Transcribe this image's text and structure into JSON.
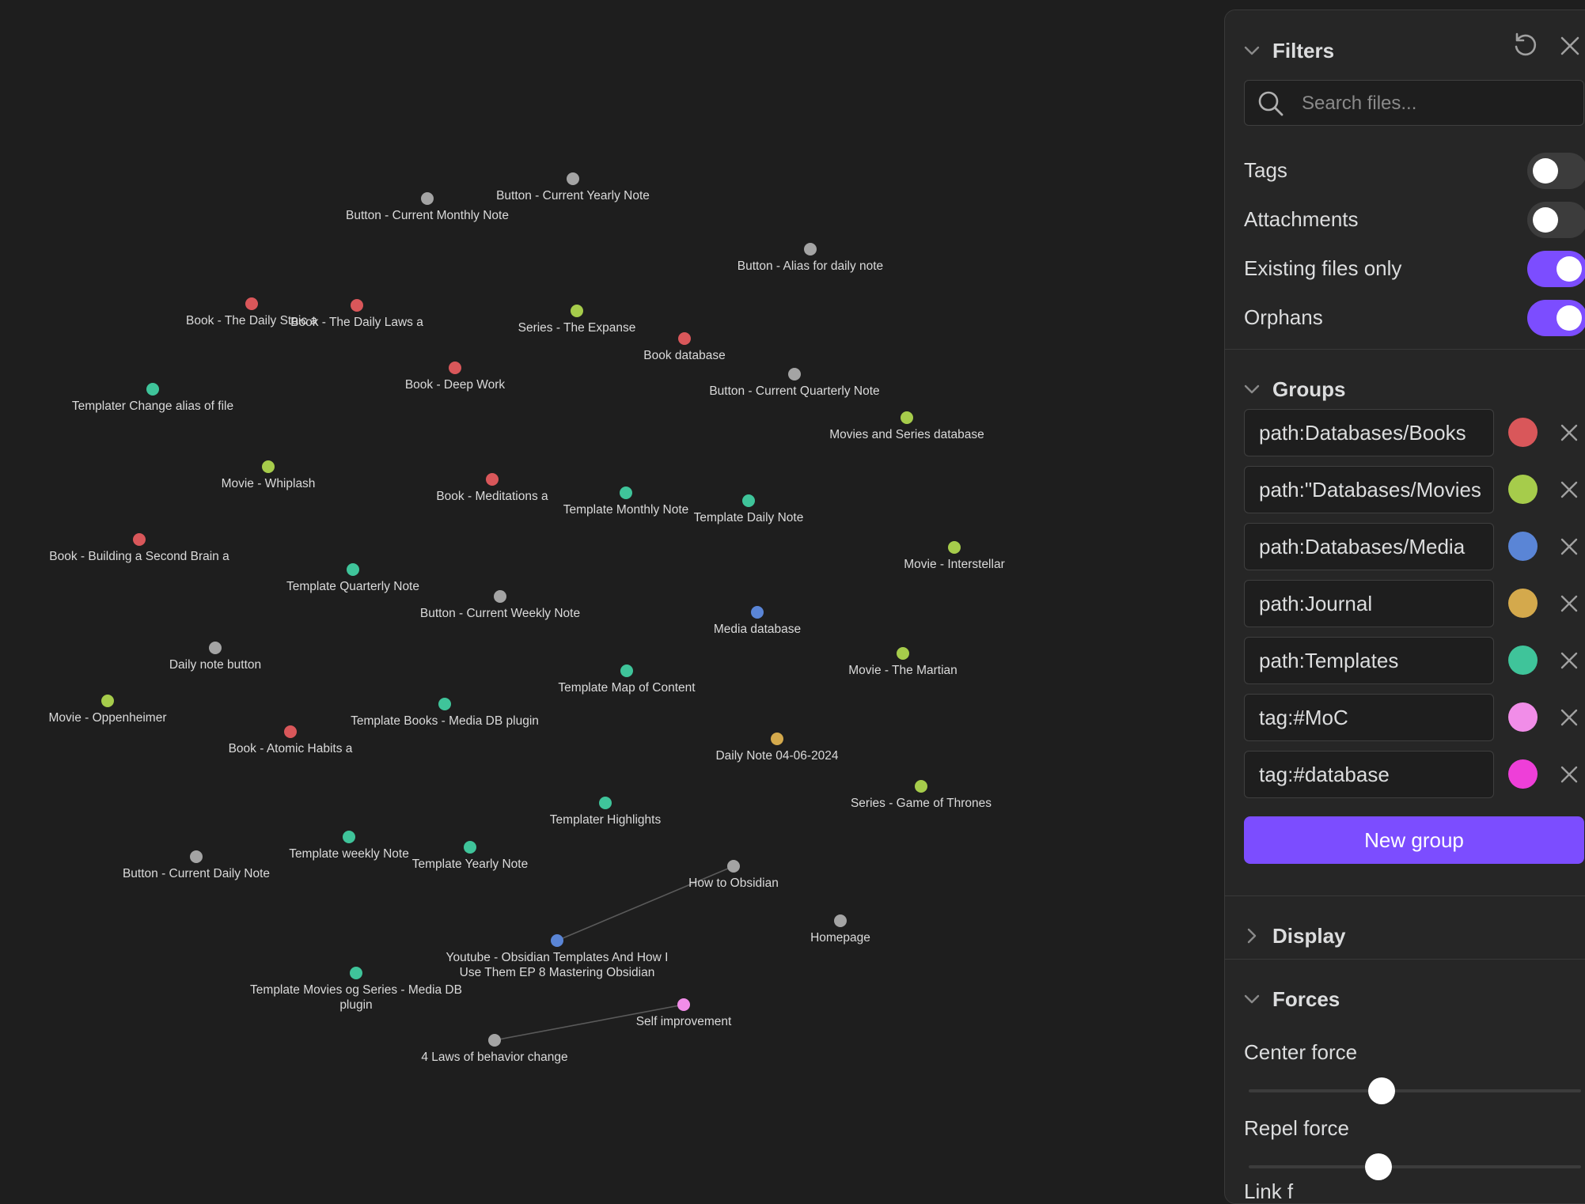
{
  "graph": {
    "colors": {
      "books": "#d9575a",
      "movies": "#a6cc4b",
      "media": "#5a85d6",
      "journal": "#d4a94c",
      "templates": "#3fc49a",
      "moc": "#f18de8",
      "default": "#a4a4a4",
      "link": "#5a5a5a"
    },
    "nodes": [
      {
        "label": "Button - Current Yearly Note",
        "group": "default"
      },
      {
        "label": "Button - Current Monthly Note",
        "group": "default"
      },
      {
        "label": "Button - Alias for daily note",
        "group": "default"
      },
      {
        "label": "Book - The Daily Stoic a",
        "group": "books"
      },
      {
        "label": "Book - The Daily Laws a",
        "group": "books"
      },
      {
        "label": "Series - The Expanse",
        "group": "movies"
      },
      {
        "label": "Book database",
        "group": "books"
      },
      {
        "label": "Button - Current Quarterly Note",
        "group": "default"
      },
      {
        "label": "Book - Deep Work",
        "group": "books"
      },
      {
        "label": "Templater Change alias of file",
        "group": "templates"
      },
      {
        "label": "Movies and Series database",
        "group": "movies"
      },
      {
        "label": "Movie - Whiplash",
        "group": "movies"
      },
      {
        "label": "Book - Meditations a",
        "group": "books"
      },
      {
        "label": "Template Monthly Note",
        "group": "templates"
      },
      {
        "label": "Template Daily Note",
        "group": "templates"
      },
      {
        "label": "Book - Building a Second Brain a",
        "group": "books"
      },
      {
        "label": "Movie - Interstellar",
        "group": "movies"
      },
      {
        "label": "Template Quarterly Note",
        "group": "templates"
      },
      {
        "label": "Button - Current Weekly Note",
        "group": "default"
      },
      {
        "label": "Media database",
        "group": "media"
      },
      {
        "label": "Daily note button",
        "group": "default"
      },
      {
        "label": "Movie - The Martian",
        "group": "movies"
      },
      {
        "label": "Template Map of Content",
        "group": "templates"
      },
      {
        "label": "Movie - Oppenheimer",
        "group": "movies"
      },
      {
        "label": "Template Books - Media DB plugin",
        "group": "templates"
      },
      {
        "label": "Book - Atomic Habits a",
        "group": "books"
      },
      {
        "label": "Daily Note 04-06-2024",
        "group": "journal"
      },
      {
        "label": "Series - Game of Thrones",
        "group": "movies"
      },
      {
        "label": "Templater Highlights",
        "group": "templates"
      },
      {
        "label": "Template weekly Note",
        "group": "templates"
      },
      {
        "label": "Button - Current Daily Note",
        "group": "default"
      },
      {
        "label": "Template Yearly Note",
        "group": "templates"
      },
      {
        "label": "How to Obsidian",
        "group": "default"
      },
      {
        "label": "Homepage",
        "group": "default"
      },
      {
        "label": "Youtube - Obsidian Templates And How I",
        "label2": "Use Them  EP 8 Mastering Obsidian",
        "group": "media"
      },
      {
        "label": "Template Movies og Series - Media DB",
        "label2": "plugin",
        "group": "templates"
      },
      {
        "label": "Self improvement",
        "group": "moc"
      },
      {
        "label": "4 Laws of behavior change",
        "group": "default"
      }
    ],
    "links": [
      {
        "source": "Youtube - Obsidian Templates And How I",
        "target": "How to Obsidian"
      },
      {
        "source": "4 Laws of behavior change",
        "target": "Self improvement"
      }
    ]
  },
  "panel": {
    "filters": {
      "title": "Filters",
      "search_placeholder": "Search files...",
      "toggles": [
        {
          "label": "Tags",
          "on": false
        },
        {
          "label": "Attachments",
          "on": false
        },
        {
          "label": "Existing files only",
          "on": true
        },
        {
          "label": "Orphans",
          "on": true
        }
      ]
    },
    "groups": {
      "title": "Groups",
      "items": [
        {
          "query": "path:Databases/Books",
          "color": "#d9575a"
        },
        {
          "query": "path:\"Databases/Movies",
          "color": "#a6cc4b"
        },
        {
          "query": "path:Databases/Media",
          "color": "#5a85d6"
        },
        {
          "query": "path:Journal",
          "color": "#d4a94c"
        },
        {
          "query": "path:Templates",
          "color": "#3fc49a"
        },
        {
          "query": "tag:#MoC",
          "color": "#f18de8"
        },
        {
          "query": "tag:#database",
          "color": "#ee3fd8"
        }
      ],
      "new_group_label": "New group"
    },
    "display": {
      "title": "Display"
    },
    "forces": {
      "title": "Forces",
      "sliders": [
        {
          "label": "Center force",
          "value": 0.4
        },
        {
          "label": "Repel force",
          "value": 0.39
        }
      ],
      "next_label": "Link f"
    }
  }
}
